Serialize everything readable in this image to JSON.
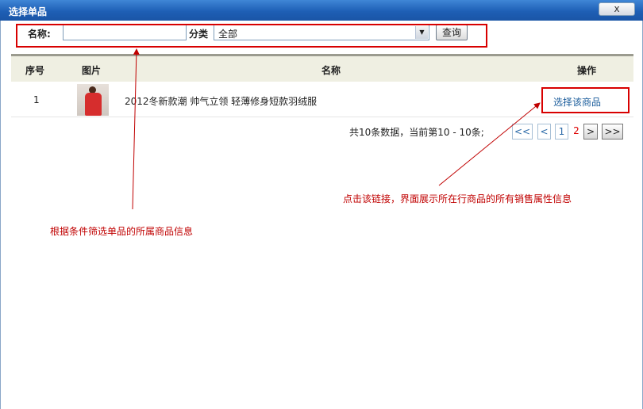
{
  "window": {
    "title": "选择单品",
    "close_label": "x"
  },
  "search": {
    "name_label": "名称:",
    "name_value": "",
    "category_label": "分类",
    "category_value": "全部",
    "query_label": "查询"
  },
  "table": {
    "headers": [
      "序号",
      "图片",
      "名称",
      "操作"
    ],
    "rows": [
      {
        "index": "1",
        "image": "product-thumbnail",
        "name": "2012冬新款潮 帅气立领 轻薄修身短款羽绒服",
        "action": "选择该商品"
      }
    ]
  },
  "pagination": {
    "info": "共10条数据，当前第10 - 10条;",
    "first": "<<",
    "prev": "<",
    "pages": [
      "1",
      "2"
    ],
    "current_page": "2",
    "next": ">",
    "last": ">>"
  },
  "annotations": {
    "filter_note": "根据条件筛选单品的所属商品信息",
    "link_note": "点击该链接，界面展示所在行商品的所有销售属性信息",
    "color": "#c00000"
  }
}
